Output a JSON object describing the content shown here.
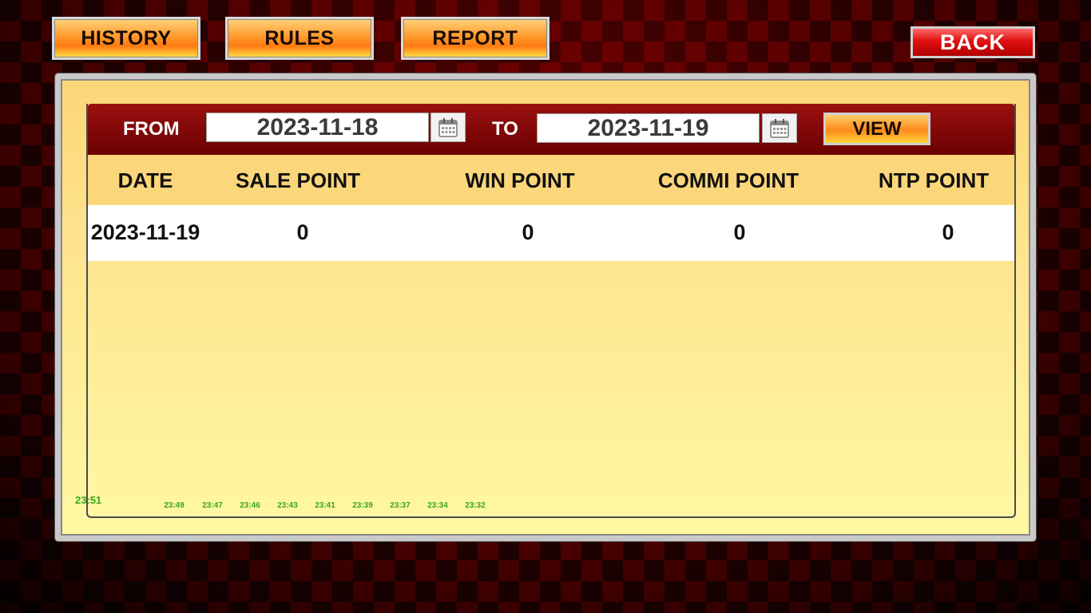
{
  "nav": {
    "history": "HISTORY",
    "rules": "RULES",
    "report": "REPORT",
    "back": "BACK"
  },
  "filter": {
    "from_label": "FROM",
    "from_date": "2023-11-18",
    "to_label": "TO",
    "to_date": "2023-11-19",
    "view_label": "VIEW"
  },
  "table": {
    "headers": [
      "DATE",
      "SALE POINT",
      "WIN POINT",
      "COMMI POINT",
      "NTP POINT"
    ],
    "rows": [
      [
        "2023-11-19",
        "0",
        "0",
        "0",
        "0"
      ]
    ]
  },
  "timeline": {
    "current": "23:51",
    "ticks": [
      "23:49",
      "23:47",
      "23:46",
      "23:43",
      "23:41",
      "23:39",
      "23:37",
      "23:34",
      "23:32"
    ]
  },
  "colors": {
    "accent_orange": "#ff8a1a",
    "back_red": "#e01010",
    "bar_red": "#8b0a0a",
    "panel_yellow": "#fff8a3",
    "time_green": "#3aa81a"
  }
}
